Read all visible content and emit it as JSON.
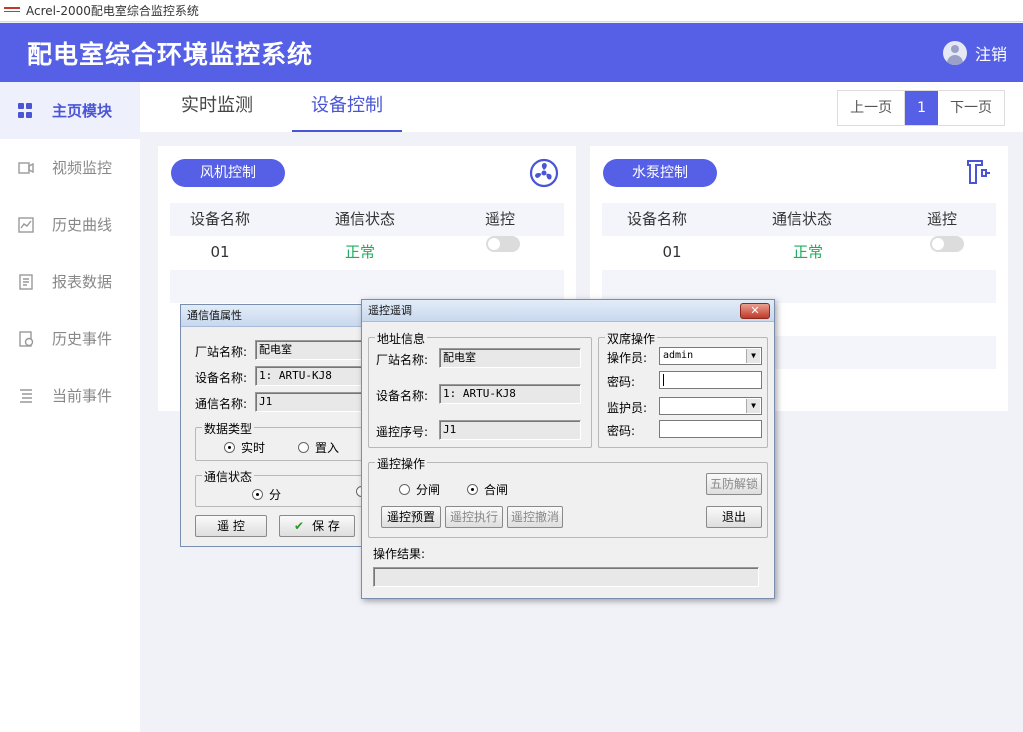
{
  "window": {
    "title": "Acrel-2000配电室综合监控系统"
  },
  "header": {
    "title": "配电室综合环境监控系统",
    "logout_label": "注销"
  },
  "sidebar": {
    "items": [
      {
        "label": "主页模块",
        "icon": "grid-icon"
      },
      {
        "label": "视频监控",
        "icon": "video-icon"
      },
      {
        "label": "历史曲线",
        "icon": "chart-icon"
      },
      {
        "label": "报表数据",
        "icon": "report-icon"
      },
      {
        "label": "历史事件",
        "icon": "event-icon"
      },
      {
        "label": "当前事件",
        "icon": "list-icon"
      }
    ]
  },
  "tabs": [
    {
      "label": "实时监测"
    },
    {
      "label": "设备控制"
    }
  ],
  "pager": {
    "prev": "上一页",
    "current": "1",
    "next": "下一页"
  },
  "panels": {
    "fan": {
      "title": "风机控制",
      "columns": [
        "设备名称",
        "通信状态",
        "遥控"
      ],
      "rows": [
        {
          "name": "01",
          "status": "正常"
        }
      ]
    },
    "pump": {
      "title": "水泵控制",
      "columns": [
        "设备名称",
        "通信状态",
        "遥控"
      ],
      "rows": [
        {
          "name": "01",
          "status": "正常"
        }
      ]
    }
  },
  "dialog_comm": {
    "title": "通信值属性",
    "station_label": "厂站名称:",
    "station_value": "配电室",
    "device_label": "设备名称:",
    "device_value": "1: ARTU-KJ8",
    "comm_label": "通信名称:",
    "comm_value": "J1",
    "datatype_group": "数据类型",
    "opt_realtime": "实时",
    "opt_set": "置入",
    "status_group": "通信状态",
    "opt_off": "分",
    "btn_remote": "遥  控",
    "btn_save": "保  存"
  },
  "dialog_remote": {
    "title": "遥控遥调",
    "address_group": "地址信息",
    "station_label": "厂站名称:",
    "station_value": "配电室",
    "device_label": "设备名称:",
    "device_value": "1: ARTU-KJ8",
    "seq_label": "遥控序号:",
    "seq_value": "J1",
    "dual_group": "双席操作",
    "operator_label": "操作员:",
    "operator_value": "admin",
    "pwd_label": "密码:",
    "guardian_label": "监护员:",
    "guardian_value": "",
    "pwd2_label": "密码:",
    "op_group": "遥控操作",
    "opt_open": "分闸",
    "opt_close": "合闸",
    "btn_unlock": "五防解锁",
    "btn_preset": "遥控预置",
    "btn_exec": "遥控执行",
    "btn_cancel": "遥控撤消",
    "btn_exit": "退出",
    "result_label": "操作结果:",
    "result_value": ""
  }
}
